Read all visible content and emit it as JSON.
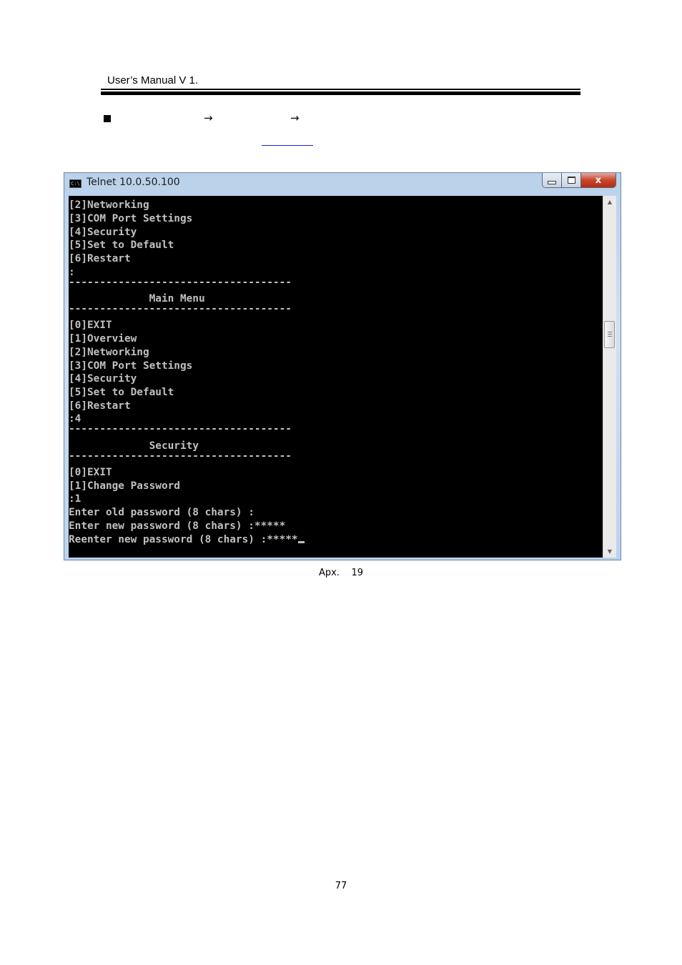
{
  "header": {
    "title": "User’s Manual V 1."
  },
  "breadcrumb": {
    "arrow1": "→",
    "arrow2": "→"
  },
  "window": {
    "title": "Telnet 10.0.50.100",
    "icon": "console-icon",
    "icon_text": "C:\\",
    "close_glyph": "x"
  },
  "console": {
    "lines": [
      "[2]Networking",
      "[3]COM Port Settings",
      "[4]Security",
      "[5]Set to Default",
      "[6]Restart",
      ":",
      "------------------------------------",
      "             Main Menu",
      "------------------------------------",
      "[0]EXIT",
      "[1]Overview",
      "[2]Networking",
      "[3]COM Port Settings",
      "[4]Security",
      "[5]Set to Default",
      "[6]Restart",
      ":4",
      "------------------------------------",
      "             Security",
      "------------------------------------",
      "[0]EXIT",
      "[1]Change Password",
      ":1",
      "Enter old password (8 chars) :",
      "Enter new password (8 chars) :*****",
      "Reenter new password (8 chars) :*****"
    ]
  },
  "caption": "Apx.    19",
  "page_number": "77"
}
